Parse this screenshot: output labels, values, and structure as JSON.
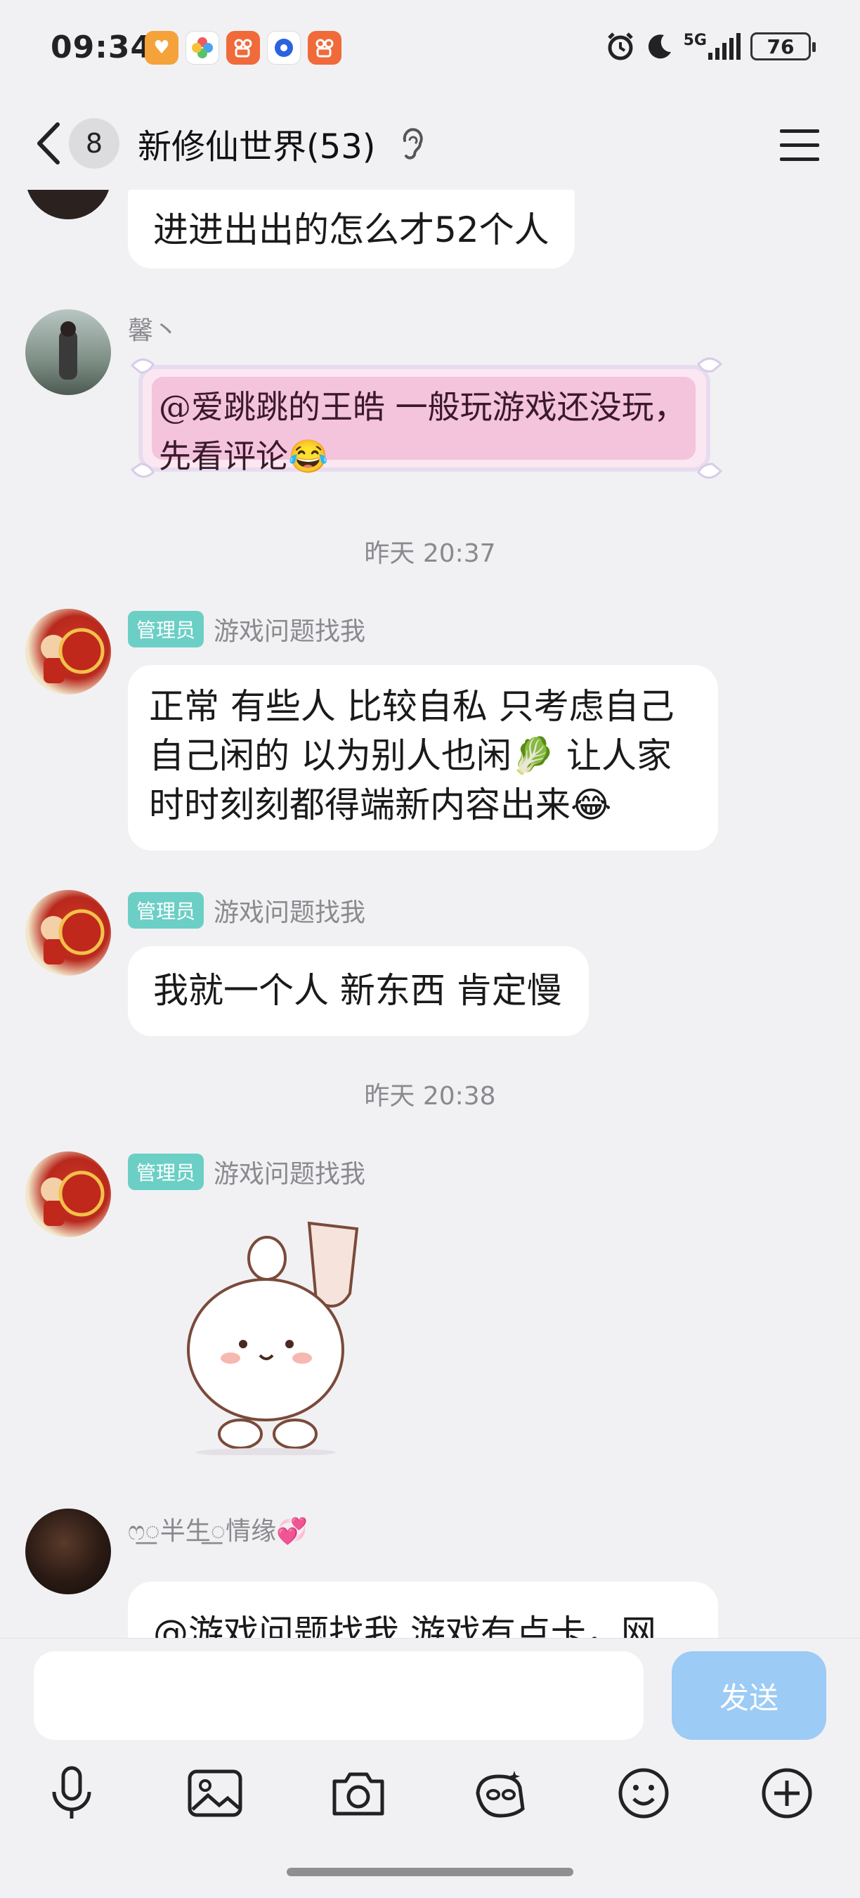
{
  "status_bar": {
    "time": "09:34",
    "network": "5G",
    "battery": "76",
    "app_icons": [
      "heart-app-icon",
      "pinwheel-app-icon",
      "kuaishou-app-icon",
      "blue-chat-app-icon",
      "kuaishou-app-icon"
    ]
  },
  "header": {
    "unread_count": "8",
    "title": "新修仙世界(53)"
  },
  "messages": [
    {
      "text": "进进出出的怎么才52个人"
    },
    {
      "sender": "馨丶",
      "text": "@爱跳跳的王皓 一般玩游戏还没玩，先看评论😂"
    },
    {
      "timestamp": "昨天 20:37"
    },
    {
      "tag": "管理员",
      "sender": "游戏问题找我",
      "text_lines": [
        "正常 有些人 比较自私 只考虑自己",
        "自己闲的 以为别人也闲🥬 让人家",
        "时时刻刻都得端新内容出来😂"
      ]
    },
    {
      "tag": "管理员",
      "sender": "游戏问题找我",
      "text": "我就一个人 新东西 肯定慢"
    },
    {
      "timestamp": "昨天 20:38"
    },
    {
      "tag": "管理员",
      "sender": "游戏问题找我"
    },
    {
      "sender": "ෆ꯭半生꯭情缘💞",
      "text": "@游戏问题找我 游戏有点卡，网"
    }
  ],
  "input": {
    "placeholder": "",
    "send_label": "发送"
  },
  "toolbar": [
    "mic-icon",
    "image-icon",
    "camera-icon",
    "red-packet-icon",
    "emoji-icon",
    "plus-icon"
  ]
}
